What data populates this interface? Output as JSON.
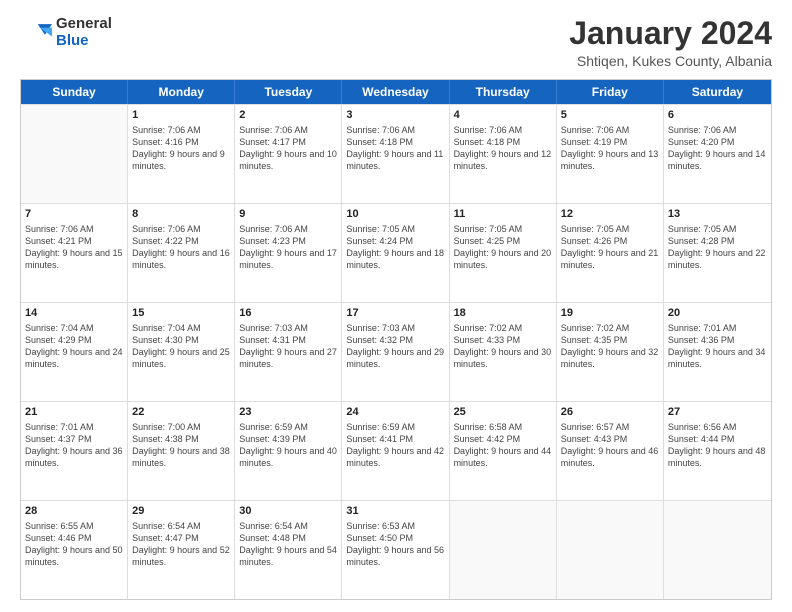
{
  "logo": {
    "general": "General",
    "blue": "Blue"
  },
  "title": "January 2024",
  "subtitle": "Shtiqen, Kukes County, Albania",
  "header_days": [
    "Sunday",
    "Monday",
    "Tuesday",
    "Wednesday",
    "Thursday",
    "Friday",
    "Saturday"
  ],
  "weeks": [
    [
      {
        "day": "",
        "sunrise": "",
        "sunset": "",
        "daylight": ""
      },
      {
        "day": "1",
        "sunrise": "Sunrise: 7:06 AM",
        "sunset": "Sunset: 4:16 PM",
        "daylight": "Daylight: 9 hours and 9 minutes."
      },
      {
        "day": "2",
        "sunrise": "Sunrise: 7:06 AM",
        "sunset": "Sunset: 4:17 PM",
        "daylight": "Daylight: 9 hours and 10 minutes."
      },
      {
        "day": "3",
        "sunrise": "Sunrise: 7:06 AM",
        "sunset": "Sunset: 4:18 PM",
        "daylight": "Daylight: 9 hours and 11 minutes."
      },
      {
        "day": "4",
        "sunrise": "Sunrise: 7:06 AM",
        "sunset": "Sunset: 4:18 PM",
        "daylight": "Daylight: 9 hours and 12 minutes."
      },
      {
        "day": "5",
        "sunrise": "Sunrise: 7:06 AM",
        "sunset": "Sunset: 4:19 PM",
        "daylight": "Daylight: 9 hours and 13 minutes."
      },
      {
        "day": "6",
        "sunrise": "Sunrise: 7:06 AM",
        "sunset": "Sunset: 4:20 PM",
        "daylight": "Daylight: 9 hours and 14 minutes."
      }
    ],
    [
      {
        "day": "7",
        "sunrise": "Sunrise: 7:06 AM",
        "sunset": "Sunset: 4:21 PM",
        "daylight": "Daylight: 9 hours and 15 minutes."
      },
      {
        "day": "8",
        "sunrise": "Sunrise: 7:06 AM",
        "sunset": "Sunset: 4:22 PM",
        "daylight": "Daylight: 9 hours and 16 minutes."
      },
      {
        "day": "9",
        "sunrise": "Sunrise: 7:06 AM",
        "sunset": "Sunset: 4:23 PM",
        "daylight": "Daylight: 9 hours and 17 minutes."
      },
      {
        "day": "10",
        "sunrise": "Sunrise: 7:05 AM",
        "sunset": "Sunset: 4:24 PM",
        "daylight": "Daylight: 9 hours and 18 minutes."
      },
      {
        "day": "11",
        "sunrise": "Sunrise: 7:05 AM",
        "sunset": "Sunset: 4:25 PM",
        "daylight": "Daylight: 9 hours and 20 minutes."
      },
      {
        "day": "12",
        "sunrise": "Sunrise: 7:05 AM",
        "sunset": "Sunset: 4:26 PM",
        "daylight": "Daylight: 9 hours and 21 minutes."
      },
      {
        "day": "13",
        "sunrise": "Sunrise: 7:05 AM",
        "sunset": "Sunset: 4:28 PM",
        "daylight": "Daylight: 9 hours and 22 minutes."
      }
    ],
    [
      {
        "day": "14",
        "sunrise": "Sunrise: 7:04 AM",
        "sunset": "Sunset: 4:29 PM",
        "daylight": "Daylight: 9 hours and 24 minutes."
      },
      {
        "day": "15",
        "sunrise": "Sunrise: 7:04 AM",
        "sunset": "Sunset: 4:30 PM",
        "daylight": "Daylight: 9 hours and 25 minutes."
      },
      {
        "day": "16",
        "sunrise": "Sunrise: 7:03 AM",
        "sunset": "Sunset: 4:31 PM",
        "daylight": "Daylight: 9 hours and 27 minutes."
      },
      {
        "day": "17",
        "sunrise": "Sunrise: 7:03 AM",
        "sunset": "Sunset: 4:32 PM",
        "daylight": "Daylight: 9 hours and 29 minutes."
      },
      {
        "day": "18",
        "sunrise": "Sunrise: 7:02 AM",
        "sunset": "Sunset: 4:33 PM",
        "daylight": "Daylight: 9 hours and 30 minutes."
      },
      {
        "day": "19",
        "sunrise": "Sunrise: 7:02 AM",
        "sunset": "Sunset: 4:35 PM",
        "daylight": "Daylight: 9 hours and 32 minutes."
      },
      {
        "day": "20",
        "sunrise": "Sunrise: 7:01 AM",
        "sunset": "Sunset: 4:36 PM",
        "daylight": "Daylight: 9 hours and 34 minutes."
      }
    ],
    [
      {
        "day": "21",
        "sunrise": "Sunrise: 7:01 AM",
        "sunset": "Sunset: 4:37 PM",
        "daylight": "Daylight: 9 hours and 36 minutes."
      },
      {
        "day": "22",
        "sunrise": "Sunrise: 7:00 AM",
        "sunset": "Sunset: 4:38 PM",
        "daylight": "Daylight: 9 hours and 38 minutes."
      },
      {
        "day": "23",
        "sunrise": "Sunrise: 6:59 AM",
        "sunset": "Sunset: 4:39 PM",
        "daylight": "Daylight: 9 hours and 40 minutes."
      },
      {
        "day": "24",
        "sunrise": "Sunrise: 6:59 AM",
        "sunset": "Sunset: 4:41 PM",
        "daylight": "Daylight: 9 hours and 42 minutes."
      },
      {
        "day": "25",
        "sunrise": "Sunrise: 6:58 AM",
        "sunset": "Sunset: 4:42 PM",
        "daylight": "Daylight: 9 hours and 44 minutes."
      },
      {
        "day": "26",
        "sunrise": "Sunrise: 6:57 AM",
        "sunset": "Sunset: 4:43 PM",
        "daylight": "Daylight: 9 hours and 46 minutes."
      },
      {
        "day": "27",
        "sunrise": "Sunrise: 6:56 AM",
        "sunset": "Sunset: 4:44 PM",
        "daylight": "Daylight: 9 hours and 48 minutes."
      }
    ],
    [
      {
        "day": "28",
        "sunrise": "Sunrise: 6:55 AM",
        "sunset": "Sunset: 4:46 PM",
        "daylight": "Daylight: 9 hours and 50 minutes."
      },
      {
        "day": "29",
        "sunrise": "Sunrise: 6:54 AM",
        "sunset": "Sunset: 4:47 PM",
        "daylight": "Daylight: 9 hours and 52 minutes."
      },
      {
        "day": "30",
        "sunrise": "Sunrise: 6:54 AM",
        "sunset": "Sunset: 4:48 PM",
        "daylight": "Daylight: 9 hours and 54 minutes."
      },
      {
        "day": "31",
        "sunrise": "Sunrise: 6:53 AM",
        "sunset": "Sunset: 4:50 PM",
        "daylight": "Daylight: 9 hours and 56 minutes."
      },
      {
        "day": "",
        "sunrise": "",
        "sunset": "",
        "daylight": ""
      },
      {
        "day": "",
        "sunrise": "",
        "sunset": "",
        "daylight": ""
      },
      {
        "day": "",
        "sunrise": "",
        "sunset": "",
        "daylight": ""
      }
    ]
  ]
}
